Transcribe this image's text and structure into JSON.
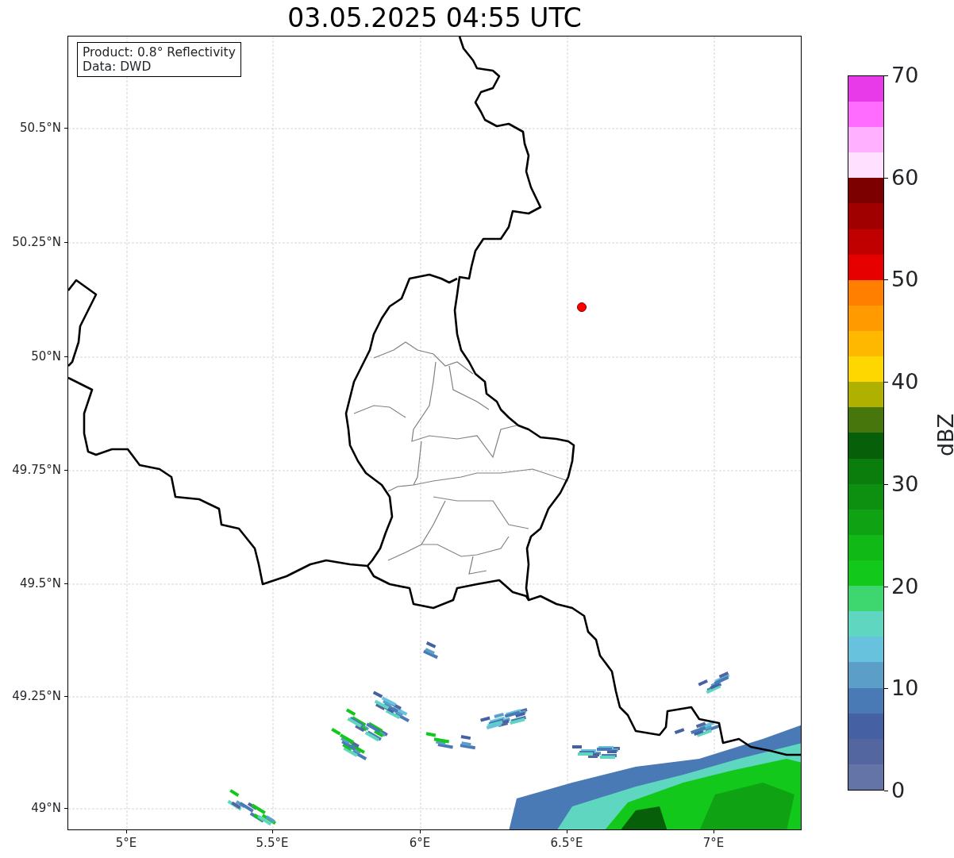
{
  "title": "03.05.2025 04:55 UTC",
  "info_box": [
    "Product: 0.8° Reflectivity",
    "Data: DWD"
  ],
  "map": {
    "y_ticks": [
      "50.5°N",
      "50.25°N",
      "50°N",
      "49.75°N",
      "49.5°N",
      "49.25°N",
      "49°N"
    ],
    "x_ticks": [
      "5°E",
      "5.5°E",
      "6°E",
      "6.5°E",
      "7°E"
    ]
  },
  "colorbar": {
    "label": "dBZ",
    "ticks": [
      "70",
      "60",
      "50",
      "40",
      "30",
      "20",
      "10",
      "0"
    ],
    "bands": [
      {
        "color": "#6574a7"
      },
      {
        "color": "#5466a0"
      },
      {
        "color": "#4560a3"
      },
      {
        "color": "#4a7ab5"
      },
      {
        "color": "#5b9ec8"
      },
      {
        "color": "#66c2dd"
      },
      {
        "color": "#5fd6c0"
      },
      {
        "color": "#3ed66f"
      },
      {
        "color": "#12c81a"
      },
      {
        "color": "#11b916"
      },
      {
        "color": "#0fa212"
      },
      {
        "color": "#0d8f0f"
      },
      {
        "color": "#0b7d0d"
      },
      {
        "color": "#076009"
      },
      {
        "color": "#47770c"
      },
      {
        "color": "#b0b000"
      },
      {
        "color": "#ffd700"
      },
      {
        "color": "#ffb800"
      },
      {
        "color": "#ff9a00"
      },
      {
        "color": "#ff7f00"
      },
      {
        "color": "#e60000"
      },
      {
        "color": "#c00000"
      },
      {
        "color": "#a00000"
      },
      {
        "color": "#7c0000"
      },
      {
        "color": "#ffe0ff"
      },
      {
        "color": "#ffb0ff"
      },
      {
        "color": "#ff6cff"
      },
      {
        "color": "#e83ae8"
      }
    ]
  }
}
